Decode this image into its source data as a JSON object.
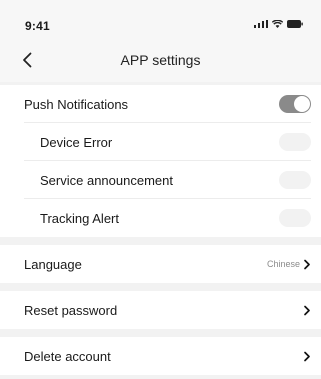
{
  "status_bar": {
    "time": "9:41"
  },
  "header": {
    "title": "APP settings"
  },
  "notifications": {
    "push": {
      "label": "Push Notifications",
      "enabled": true
    },
    "device_error": {
      "label": "Device Error",
      "enabled": false
    },
    "service_announcement": {
      "label": "Service announcement",
      "enabled": false
    },
    "tracking_alert": {
      "label": "Tracking Alert",
      "enabled": false
    }
  },
  "language": {
    "label": "Language",
    "value": "Chinese"
  },
  "reset_password": {
    "label": "Reset password"
  },
  "delete_account": {
    "label": "Delete account"
  },
  "icons": [
    "back-arrow-icon",
    "signal-icon",
    "wifi-icon",
    "battery-icon",
    "chevron-right-icon"
  ]
}
